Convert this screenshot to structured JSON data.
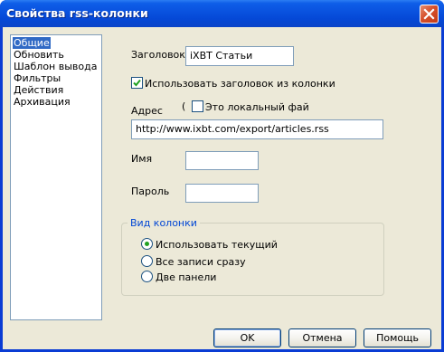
{
  "window": {
    "title": "Свойства rss-колонки"
  },
  "sections": [
    {
      "label": "Общие",
      "selected": true
    },
    {
      "label": "Обновить",
      "selected": false
    },
    {
      "label": "Шаблон вывода",
      "selected": false
    },
    {
      "label": "Фильтры",
      "selected": false
    },
    {
      "label": "Действия",
      "selected": false
    },
    {
      "label": "Архивация",
      "selected": false
    }
  ],
  "form": {
    "header_label": "Заголовок",
    "header_value": "iXBT Статьи",
    "use_column_header_label": "Использовать заголовок из колонки",
    "use_column_header_checked": true,
    "address_label": "Адрес",
    "address_paren": "(",
    "local_file_label": "Это локальный фай",
    "local_file_checked": false,
    "address_value": "http://www.ixbt.com/export/articles.rss",
    "name_label": "Имя",
    "name_value": "",
    "password_label": "Пароль",
    "password_value": ""
  },
  "column_view": {
    "title": "Вид колонки",
    "options": [
      {
        "label": "Использовать текущий",
        "selected": true
      },
      {
        "label": "Все записи сразу",
        "selected": false
      },
      {
        "label": "Две панели",
        "selected": false
      }
    ]
  },
  "buttons": {
    "ok": "OK",
    "cancel": "Отмена",
    "help": "Помощь"
  }
}
